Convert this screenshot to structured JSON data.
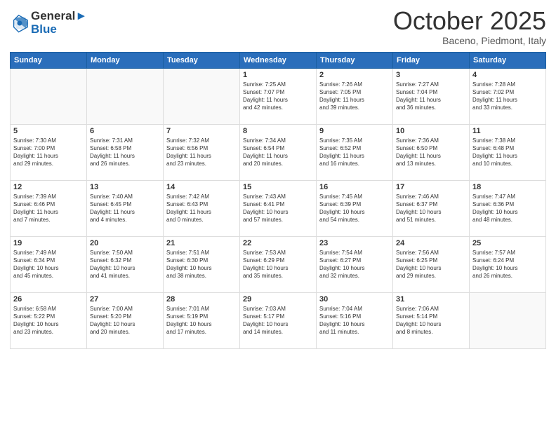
{
  "header": {
    "logo_line1": "General",
    "logo_line2": "Blue",
    "month": "October 2025",
    "location": "Baceno, Piedmont, Italy"
  },
  "days_of_week": [
    "Sunday",
    "Monday",
    "Tuesday",
    "Wednesday",
    "Thursday",
    "Friday",
    "Saturday"
  ],
  "weeks": [
    [
      {
        "day": "",
        "info": ""
      },
      {
        "day": "",
        "info": ""
      },
      {
        "day": "",
        "info": ""
      },
      {
        "day": "1",
        "info": "Sunrise: 7:25 AM\nSunset: 7:07 PM\nDaylight: 11 hours\nand 42 minutes."
      },
      {
        "day": "2",
        "info": "Sunrise: 7:26 AM\nSunset: 7:05 PM\nDaylight: 11 hours\nand 39 minutes."
      },
      {
        "day": "3",
        "info": "Sunrise: 7:27 AM\nSunset: 7:04 PM\nDaylight: 11 hours\nand 36 minutes."
      },
      {
        "day": "4",
        "info": "Sunrise: 7:28 AM\nSunset: 7:02 PM\nDaylight: 11 hours\nand 33 minutes."
      }
    ],
    [
      {
        "day": "5",
        "info": "Sunrise: 7:30 AM\nSunset: 7:00 PM\nDaylight: 11 hours\nand 29 minutes."
      },
      {
        "day": "6",
        "info": "Sunrise: 7:31 AM\nSunset: 6:58 PM\nDaylight: 11 hours\nand 26 minutes."
      },
      {
        "day": "7",
        "info": "Sunrise: 7:32 AM\nSunset: 6:56 PM\nDaylight: 11 hours\nand 23 minutes."
      },
      {
        "day": "8",
        "info": "Sunrise: 7:34 AM\nSunset: 6:54 PM\nDaylight: 11 hours\nand 20 minutes."
      },
      {
        "day": "9",
        "info": "Sunrise: 7:35 AM\nSunset: 6:52 PM\nDaylight: 11 hours\nand 16 minutes."
      },
      {
        "day": "10",
        "info": "Sunrise: 7:36 AM\nSunset: 6:50 PM\nDaylight: 11 hours\nand 13 minutes."
      },
      {
        "day": "11",
        "info": "Sunrise: 7:38 AM\nSunset: 6:48 PM\nDaylight: 11 hours\nand 10 minutes."
      }
    ],
    [
      {
        "day": "12",
        "info": "Sunrise: 7:39 AM\nSunset: 6:46 PM\nDaylight: 11 hours\nand 7 minutes."
      },
      {
        "day": "13",
        "info": "Sunrise: 7:40 AM\nSunset: 6:45 PM\nDaylight: 11 hours\nand 4 minutes."
      },
      {
        "day": "14",
        "info": "Sunrise: 7:42 AM\nSunset: 6:43 PM\nDaylight: 11 hours\nand 0 minutes."
      },
      {
        "day": "15",
        "info": "Sunrise: 7:43 AM\nSunset: 6:41 PM\nDaylight: 10 hours\nand 57 minutes."
      },
      {
        "day": "16",
        "info": "Sunrise: 7:45 AM\nSunset: 6:39 PM\nDaylight: 10 hours\nand 54 minutes."
      },
      {
        "day": "17",
        "info": "Sunrise: 7:46 AM\nSunset: 6:37 PM\nDaylight: 10 hours\nand 51 minutes."
      },
      {
        "day": "18",
        "info": "Sunrise: 7:47 AM\nSunset: 6:36 PM\nDaylight: 10 hours\nand 48 minutes."
      }
    ],
    [
      {
        "day": "19",
        "info": "Sunrise: 7:49 AM\nSunset: 6:34 PM\nDaylight: 10 hours\nand 45 minutes."
      },
      {
        "day": "20",
        "info": "Sunrise: 7:50 AM\nSunset: 6:32 PM\nDaylight: 10 hours\nand 41 minutes."
      },
      {
        "day": "21",
        "info": "Sunrise: 7:51 AM\nSunset: 6:30 PM\nDaylight: 10 hours\nand 38 minutes."
      },
      {
        "day": "22",
        "info": "Sunrise: 7:53 AM\nSunset: 6:29 PM\nDaylight: 10 hours\nand 35 minutes."
      },
      {
        "day": "23",
        "info": "Sunrise: 7:54 AM\nSunset: 6:27 PM\nDaylight: 10 hours\nand 32 minutes."
      },
      {
        "day": "24",
        "info": "Sunrise: 7:56 AM\nSunset: 6:25 PM\nDaylight: 10 hours\nand 29 minutes."
      },
      {
        "day": "25",
        "info": "Sunrise: 7:57 AM\nSunset: 6:24 PM\nDaylight: 10 hours\nand 26 minutes."
      }
    ],
    [
      {
        "day": "26",
        "info": "Sunrise: 6:58 AM\nSunset: 5:22 PM\nDaylight: 10 hours\nand 23 minutes."
      },
      {
        "day": "27",
        "info": "Sunrise: 7:00 AM\nSunset: 5:20 PM\nDaylight: 10 hours\nand 20 minutes."
      },
      {
        "day": "28",
        "info": "Sunrise: 7:01 AM\nSunset: 5:19 PM\nDaylight: 10 hours\nand 17 minutes."
      },
      {
        "day": "29",
        "info": "Sunrise: 7:03 AM\nSunset: 5:17 PM\nDaylight: 10 hours\nand 14 minutes."
      },
      {
        "day": "30",
        "info": "Sunrise: 7:04 AM\nSunset: 5:16 PM\nDaylight: 10 hours\nand 11 minutes."
      },
      {
        "day": "31",
        "info": "Sunrise: 7:06 AM\nSunset: 5:14 PM\nDaylight: 10 hours\nand 8 minutes."
      },
      {
        "day": "",
        "info": ""
      }
    ]
  ]
}
